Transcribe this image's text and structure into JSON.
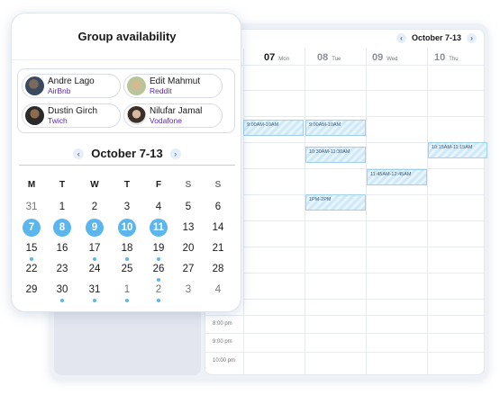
{
  "week_calendar": {
    "range_label": "October 7-13",
    "days": [
      {
        "num": "07",
        "weekday": "Mon"
      },
      {
        "num": "08",
        "weekday": "Tue"
      },
      {
        "num": "09",
        "weekday": "Wed"
      },
      {
        "num": "10",
        "weekday": "Thu"
      }
    ],
    "time_labels": [
      "8:00 pm",
      "9:00 pm",
      "10:00 pm"
    ],
    "events": [
      {
        "label": "9:00AM-10AM"
      },
      {
        "label": "9:00AM-10AM"
      },
      {
        "label": "10:30AM-11:30AM"
      },
      {
        "label": "10:15AM-11:15AM"
      },
      {
        "label": "11:45AM-12:45AM"
      },
      {
        "label": "1PM-2PM"
      }
    ]
  },
  "group": {
    "title": "Group availability",
    "people": [
      {
        "name": "Andre Lago",
        "org": "AirBnb"
      },
      {
        "name": "Edit Mahmut",
        "org": "Reddit"
      },
      {
        "name": "Dustin Girch",
        "org": "Twich"
      },
      {
        "name": "Nilufar Jamal",
        "org": "Vodafone"
      }
    ]
  },
  "month": {
    "label": "October 7-13",
    "weekdays": [
      "M",
      "T",
      "W",
      "T",
      "F",
      "S",
      "S"
    ],
    "weeks": [
      [
        "31",
        "1",
        "2",
        "3",
        "4",
        "5",
        "6"
      ],
      [
        "7",
        "8",
        "9",
        "10",
        "11",
        "13",
        "14"
      ],
      [
        "15",
        "16",
        "17",
        "18",
        "19",
        "20",
        "21"
      ],
      [
        "22",
        "23",
        "24",
        "25",
        "26",
        "27",
        "28"
      ],
      [
        "29",
        "30",
        "31",
        "1",
        "2",
        "3",
        "4"
      ]
    ]
  },
  "colors": {
    "accent": "#5bb6ee",
    "org_text": "#5b2bb5",
    "event_border": "#9fd0ee"
  }
}
